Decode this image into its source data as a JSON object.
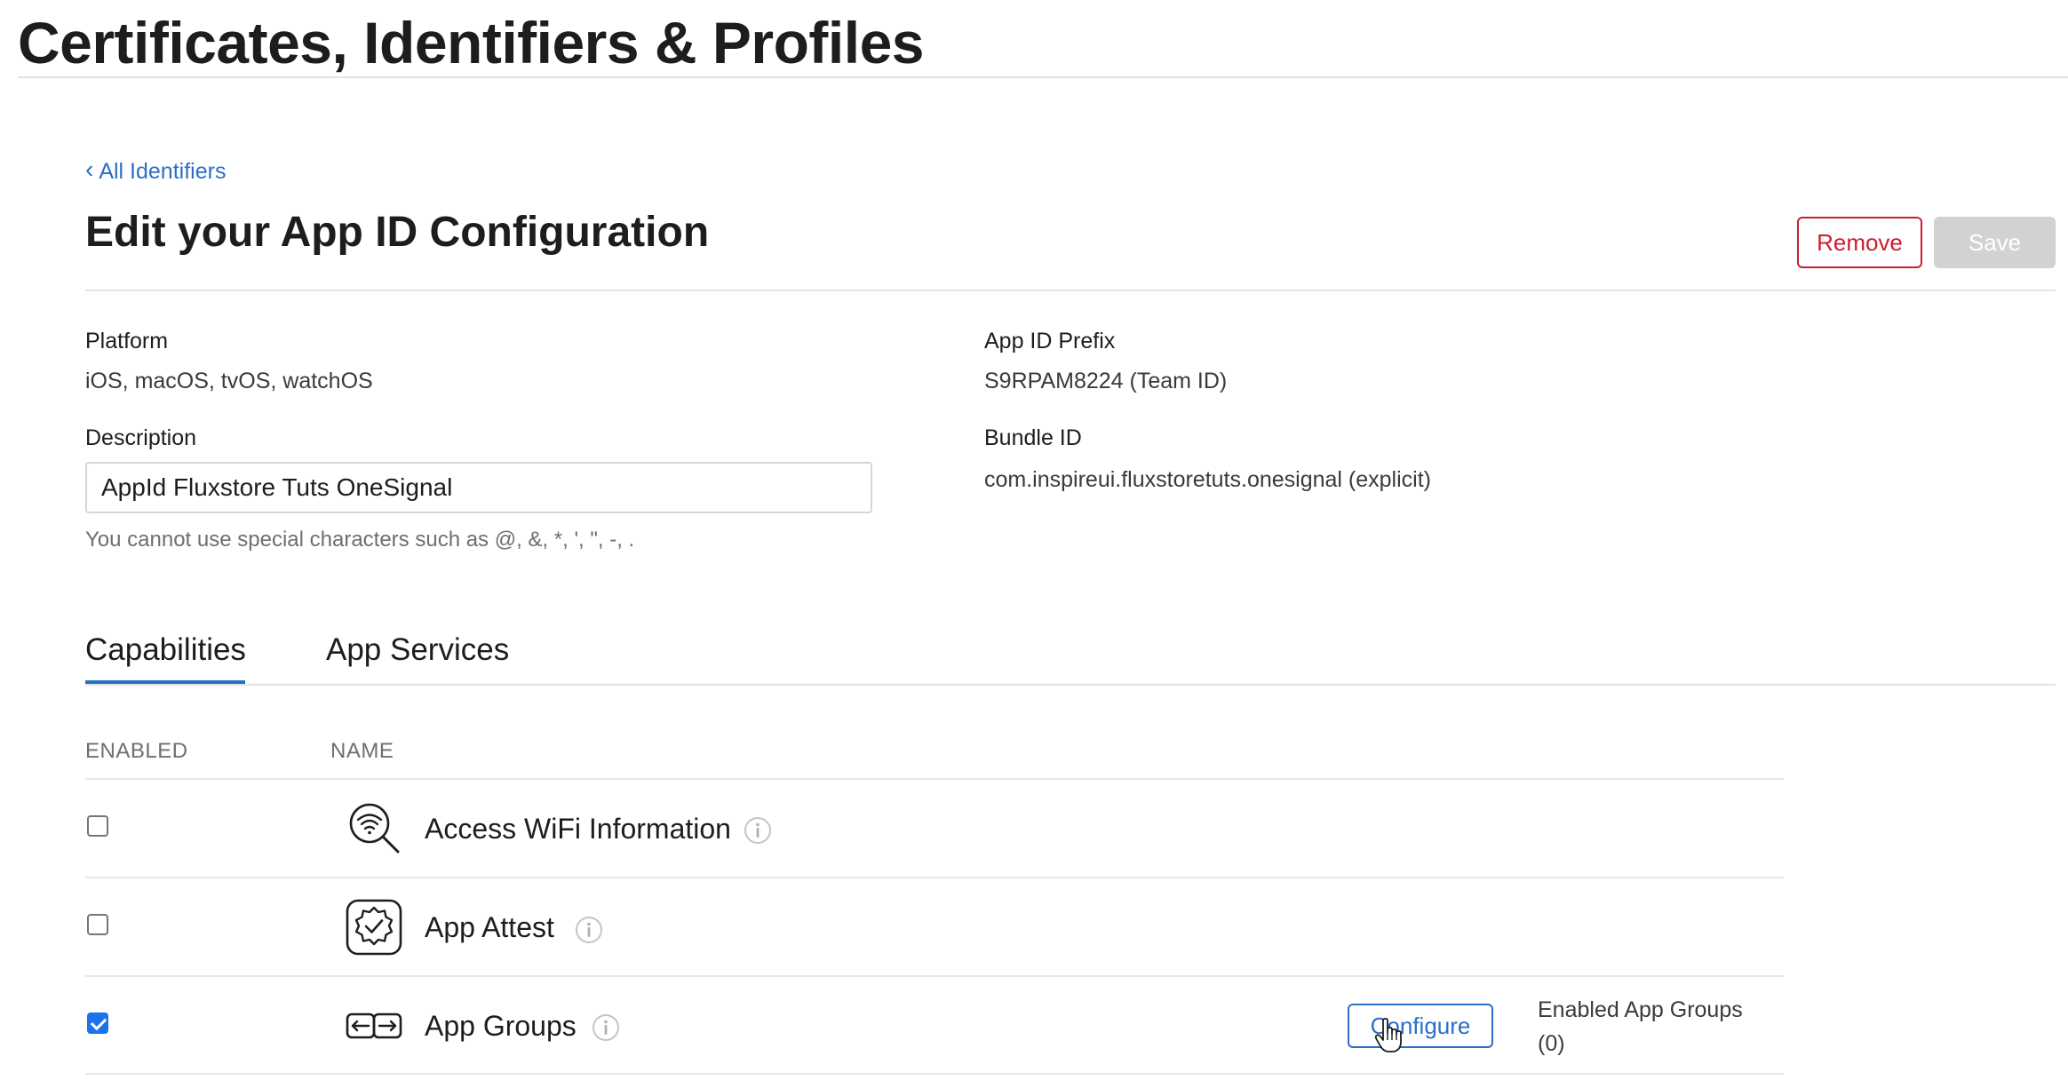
{
  "page": {
    "title": "Certificates, Identifiers & Profiles"
  },
  "breadcrumb": {
    "chevron": "‹",
    "back_label": "All Identifiers"
  },
  "section": {
    "title": "Edit your App ID Configuration"
  },
  "actions": {
    "remove_label": "Remove",
    "save_label": "Save",
    "remove_color": "#c8202e",
    "save_disabled": true
  },
  "details": {
    "platform_label": "Platform",
    "platform_value": "iOS, macOS, tvOS, watchOS",
    "description_label": "Description",
    "description_value": "AppId Fluxstore Tuts OneSignal",
    "description_hint": "You cannot use special characters such as @, &, *, ', \", -, .",
    "prefix_label": "App ID Prefix",
    "prefix_value": "S9RPAM8224 (Team ID)",
    "bundle_label": "Bundle ID",
    "bundle_value": "com.inspireui.fluxstoretuts.onesignal (explicit)"
  },
  "tabs": [
    {
      "label": "Capabilities",
      "active": true
    },
    {
      "label": "App Services",
      "active": false
    }
  ],
  "capabilities": {
    "col_enabled": "ENABLED",
    "col_name": "NAME",
    "rows": [
      {
        "name": "Access WiFi Information",
        "enabled": false,
        "icon": "wifi-search-icon"
      },
      {
        "name": "App Attest",
        "enabled": false,
        "icon": "badge-check-icon"
      },
      {
        "name": "App Groups",
        "enabled": true,
        "icon": "app-groups-icon",
        "configure_label": "Configure",
        "enabled_groups_label": "Enabled App Groups",
        "enabled_groups_count": "(0)"
      }
    ]
  },
  "colors": {
    "link": "#2a6fc7",
    "checkbox_checked": "#1a73e8"
  }
}
